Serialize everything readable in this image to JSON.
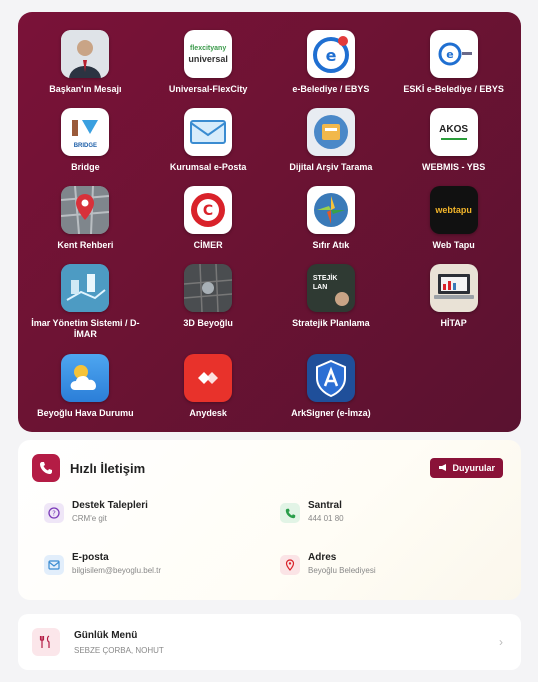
{
  "apps": [
    {
      "label": "Başkan'ın Mesajı",
      "icon": "mayor-portrait-icon"
    },
    {
      "label": "Universal-FlexCity",
      "icon": "flexcity-logo-icon",
      "logo_top": "flexcityany",
      "logo_bottom": "universal"
    },
    {
      "label": "e-Belediye / EBYS",
      "icon": "ebelediye-logo-icon"
    },
    {
      "label": "ESKİ e-Belediye / EBYS",
      "icon": "eski-ebelediye-logo-icon"
    },
    {
      "label": "Bridge",
      "icon": "bridge-logo-icon",
      "logo_text": "BRIDGE"
    },
    {
      "label": "Kurumsal e-Posta",
      "icon": "envelope-icon"
    },
    {
      "label": "Dijital Arşiv Tarama",
      "icon": "archive-scan-icon"
    },
    {
      "label": "WEBMIS - YBS",
      "icon": "akos-logo-icon",
      "logo_text": "AKOS"
    },
    {
      "label": "Kent Rehberi",
      "icon": "city-map-icon"
    },
    {
      "label": "CİMER",
      "icon": "cimer-logo-icon"
    },
    {
      "label": "Sıfır Atık",
      "icon": "zero-waste-icon"
    },
    {
      "label": "Web Tapu",
      "icon": "webtapu-logo-icon",
      "logo_text": "webtapu"
    },
    {
      "label": "İmar Yönetim Sistemi / D-İMAR",
      "icon": "zoning-city-icon"
    },
    {
      "label": "3D Beyoğlu",
      "icon": "3d-map-icon"
    },
    {
      "label": "Stratejik Planlama",
      "icon": "strategy-board-icon",
      "logo_text": "STEJİK LAN"
    },
    {
      "label": "HİTAP",
      "icon": "laptop-chart-icon"
    },
    {
      "label": "Beyoğlu Hava Durumu",
      "icon": "weather-cloud-icon"
    },
    {
      "label": "Anydesk",
      "icon": "anydesk-logo-icon"
    },
    {
      "label": "ArkSigner (e-İmza)",
      "icon": "arksigner-logo-icon"
    }
  ],
  "quick_contact": {
    "title": "Hızlı İletişim",
    "announce_label": "Duyurular",
    "items": [
      {
        "title": "Destek Talepleri",
        "sub": "CRM'e git"
      },
      {
        "title": "Santral",
        "sub": "444 01 80"
      },
      {
        "title": "E-posta",
        "sub": "bilgisilem@beyoglu.bel.tr"
      },
      {
        "title": "Adres",
        "sub": "Beyoğlu Belediyesi"
      }
    ]
  },
  "daily_menu": {
    "title": "Günlük Menü",
    "sub": "SEBZE ÇORBA, NOHUT"
  },
  "colors": {
    "panel": "#6c1333",
    "accent": "#b41c45",
    "button": "#8a1238"
  }
}
